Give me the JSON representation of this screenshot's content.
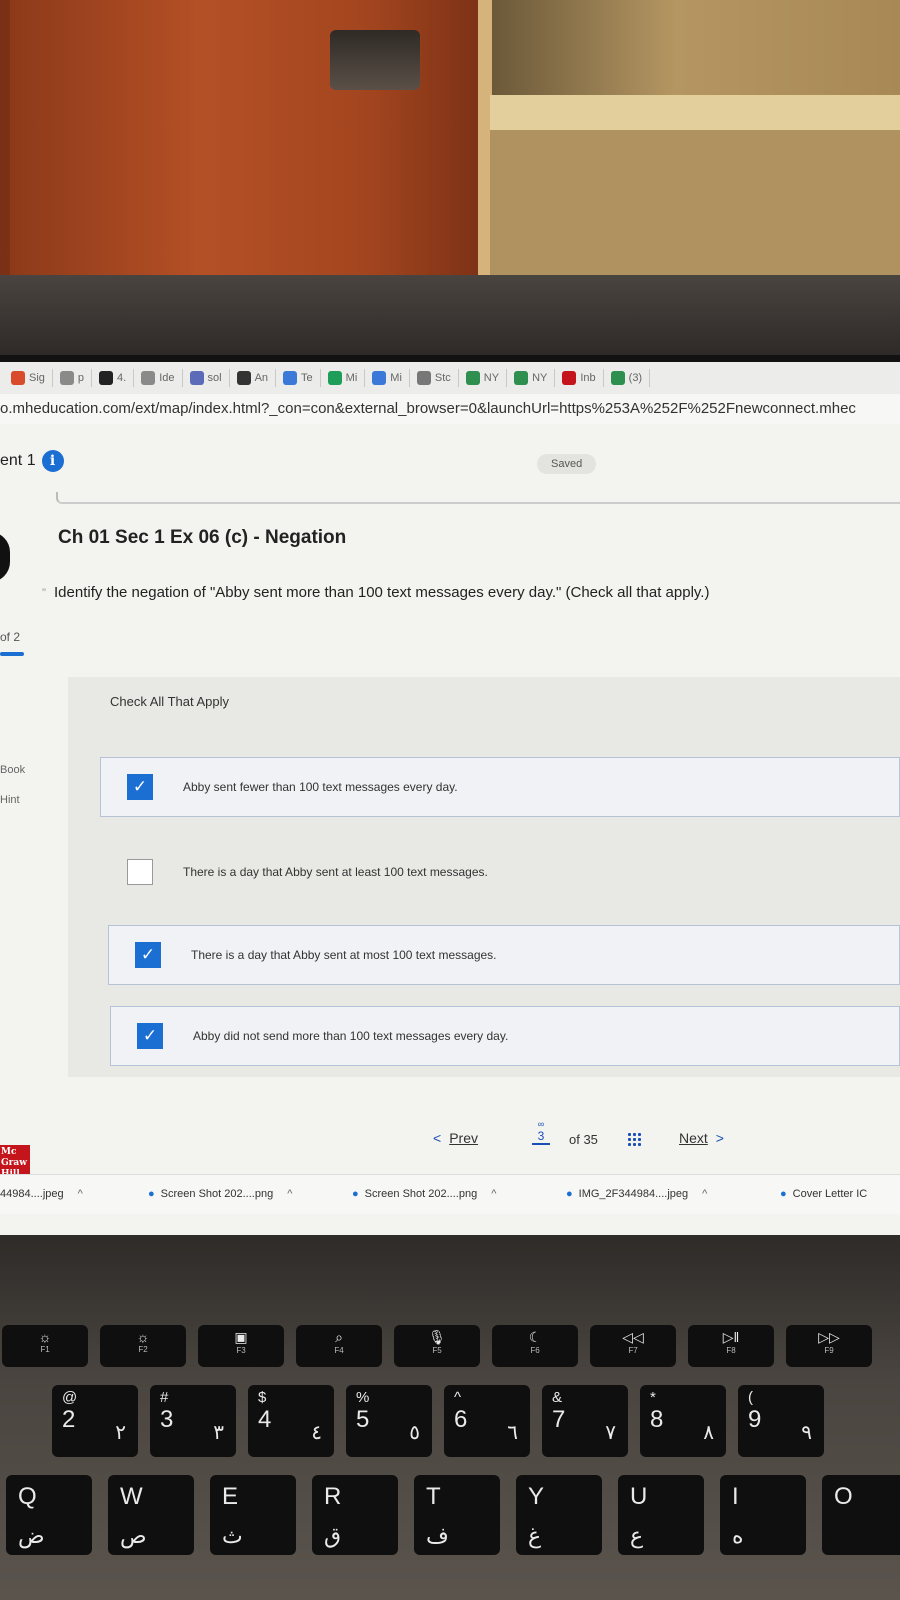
{
  "browser": {
    "bookmarks": [
      {
        "icon": "c-icon",
        "label": "Sig",
        "color": "#d94c2b"
      },
      {
        "icon": "google-icon",
        "label": "p",
        "color": "#8a8a8a"
      },
      {
        "icon": "square-icon",
        "label": "4.",
        "color": "#222222"
      },
      {
        "icon": "google-icon",
        "label": "Ide",
        "color": "#8a8a8a"
      },
      {
        "icon": "wave-icon",
        "label": "sol",
        "color": "#5b6bb7"
      },
      {
        "icon": "pen-icon",
        "label": "An",
        "color": "#333333"
      },
      {
        "icon": "doc-icon",
        "label": "Te",
        "color": "#3c78d8"
      },
      {
        "icon": "drive-icon",
        "label": "Mi",
        "color": "#1f9e5a"
      },
      {
        "icon": "doc-icon",
        "label": "Mi",
        "color": "#3c78d8"
      },
      {
        "icon": "star-icon",
        "label": "Stc",
        "color": "#777777"
      },
      {
        "icon": "g-ring-icon",
        "label": "NY",
        "color": "#2f8f4f"
      },
      {
        "icon": "g-ring-icon",
        "label": "NY",
        "color": "#2f8f4f"
      },
      {
        "icon": "gmail-icon",
        "label": "Inb",
        "color": "#c4151c"
      },
      {
        "icon": "o-icon",
        "label": "(3)",
        "color": "#2f8f4f"
      }
    ],
    "url": "o.mheducation.com/ext/map/index.html?_con=con&external_browser=0&launchUrl=https%253A%252F%252Fnewconnect.mhec"
  },
  "assignment": {
    "title": "ent 1",
    "saved_label": "Saved"
  },
  "rail": {
    "progress": "of 2",
    "progress_fraction": 1,
    "book_label": "Book",
    "hint_label": "Hint",
    "logo_text": "Mc Graw Hill"
  },
  "question": {
    "title": "Ch 01 Sec 1 Ex 06 (c) - Negation",
    "prompt": "Identify the negation of \"Abby sent more than 100 text messages every day.\" (Check all that apply.)",
    "instruction": "Check All That Apply",
    "options": [
      {
        "text": "Abby sent fewer than 100 text messages every day.",
        "checked": true
      },
      {
        "text": "There is a day that Abby sent at least 100 text messages.",
        "checked": false
      },
      {
        "text": "There is a day that Abby sent at most 100 text messages.",
        "checked": true
      },
      {
        "text": "Abby did not send more than 100 text messages every day.",
        "checked": true
      }
    ]
  },
  "pager": {
    "prev_chevron": "<",
    "prev_label": "Prev",
    "current_page": "3",
    "of_total": "of 35",
    "next_label": "Next",
    "next_chevron": ">"
  },
  "downloads": [
    {
      "name": "44984....jpeg"
    },
    {
      "name": "Screen Shot 202....png"
    },
    {
      "name": "Screen Shot 202....png"
    },
    {
      "name": "IMG_2F344984....jpeg"
    },
    {
      "name": "Cover Letter IC"
    }
  ],
  "keyboard": {
    "function_row": [
      {
        "symbol": "☼",
        "label": "F1"
      },
      {
        "symbol": "☼",
        "label": "F2"
      },
      {
        "symbol": "▣",
        "label": "F3"
      },
      {
        "symbol": "⌕",
        "label": "F4"
      },
      {
        "symbol": "🎙",
        "label": "F5"
      },
      {
        "symbol": "☾",
        "label": "F6"
      },
      {
        "symbol": "◁◁",
        "label": "F7"
      },
      {
        "symbol": "▷‖",
        "label": "F8"
      },
      {
        "symbol": "▷▷",
        "label": "F9"
      }
    ],
    "number_row": [
      {
        "shift": "@",
        "main": "2",
        "arabic": "٢"
      },
      {
        "shift": "#",
        "main": "3",
        "arabic": "٣"
      },
      {
        "shift": "$",
        "main": "4",
        "arabic": "٤"
      },
      {
        "shift": "%",
        "main": "5",
        "arabic": "٥"
      },
      {
        "shift": "^",
        "main": "6",
        "arabic": "٦"
      },
      {
        "shift": "&",
        "main": "7",
        "arabic": "٧"
      },
      {
        "shift": "*",
        "main": "8",
        "arabic": "٨"
      },
      {
        "shift": "(",
        "main": "9",
        "arabic": "٩"
      }
    ],
    "letter_row": [
      {
        "main": "Q",
        "arabic": "ض"
      },
      {
        "main": "W",
        "arabic": "ص"
      },
      {
        "main": "E",
        "arabic": "ث"
      },
      {
        "main": "R",
        "arabic": "ق"
      },
      {
        "main": "T",
        "arabic": "ف"
      },
      {
        "main": "Y",
        "arabic": "غ"
      },
      {
        "main": "U",
        "arabic": "ع"
      },
      {
        "main": "I",
        "arabic": "ه"
      },
      {
        "main": "O",
        "arabic": ""
      }
    ]
  }
}
